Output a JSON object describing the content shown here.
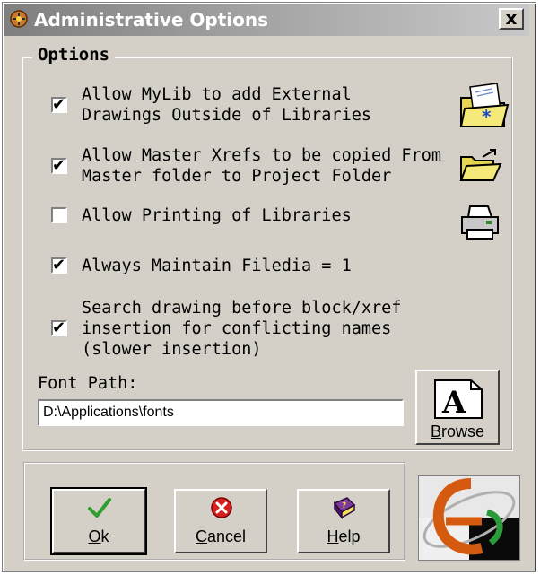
{
  "window": {
    "title": "Administrative Options",
    "close_symbol": "x"
  },
  "group": {
    "label": "Options"
  },
  "options": [
    {
      "line1": "Allow MyLib to add External",
      "line2": "Drawings Outside of Libraries",
      "checked": true,
      "icon": "open-folder-star-icon"
    },
    {
      "line1": "Allow Master Xrefs to be copied From",
      "line2": "Master folder to Project Folder",
      "checked": true,
      "icon": "folder-copy-icon"
    },
    {
      "line1": "Allow Printing of Libraries",
      "checked": false,
      "icon": "printer-icon"
    },
    {
      "line1": "Always Maintain Filedia = 1",
      "checked": true
    },
    {
      "line1": "Search drawing before block/xref",
      "line2": "insertion for conflicting names",
      "line3": "(slower insertion)",
      "checked": true
    }
  ],
  "font_path": {
    "label": "Font Path:",
    "value": "D:\\Applications\\fonts"
  },
  "browse": {
    "glyph": "A",
    "label": "Browse",
    "mnemonic": "B",
    "rest": "rowse"
  },
  "buttons": {
    "ok": {
      "mnemonic": "O",
      "rest": "k",
      "icon": "checkmark-icon"
    },
    "cancel": {
      "mnemonic": "C",
      "rest": "ancel",
      "icon": "cancel-x-icon"
    },
    "help": {
      "mnemonic": "H",
      "rest": "elp",
      "icon": "help-book-icon"
    }
  },
  "checkbox_mark": "✔",
  "colors": {
    "accent_green": "#2e9e2e",
    "cancel_red": "#d42020",
    "help_purple": "#6a2a8a",
    "folder_yellow": "#f2e25a"
  }
}
